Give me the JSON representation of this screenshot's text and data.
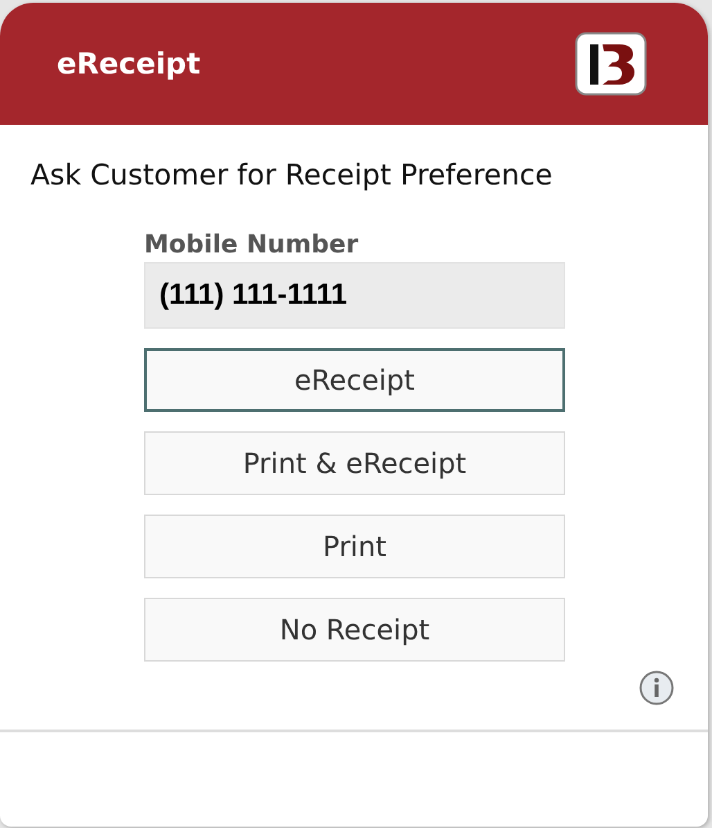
{
  "dialog": {
    "title": "eReceipt",
    "prompt": "Ask Customer for Receipt Preference",
    "mobile_field": {
      "label": "Mobile Number",
      "value": "(111) 111-1111"
    },
    "options": [
      {
        "label": "eReceipt",
        "selected": true
      },
      {
        "label": "Print & eReceipt",
        "selected": false
      },
      {
        "label": "Print",
        "selected": false
      },
      {
        "label": "No Receipt",
        "selected": false
      }
    ]
  }
}
